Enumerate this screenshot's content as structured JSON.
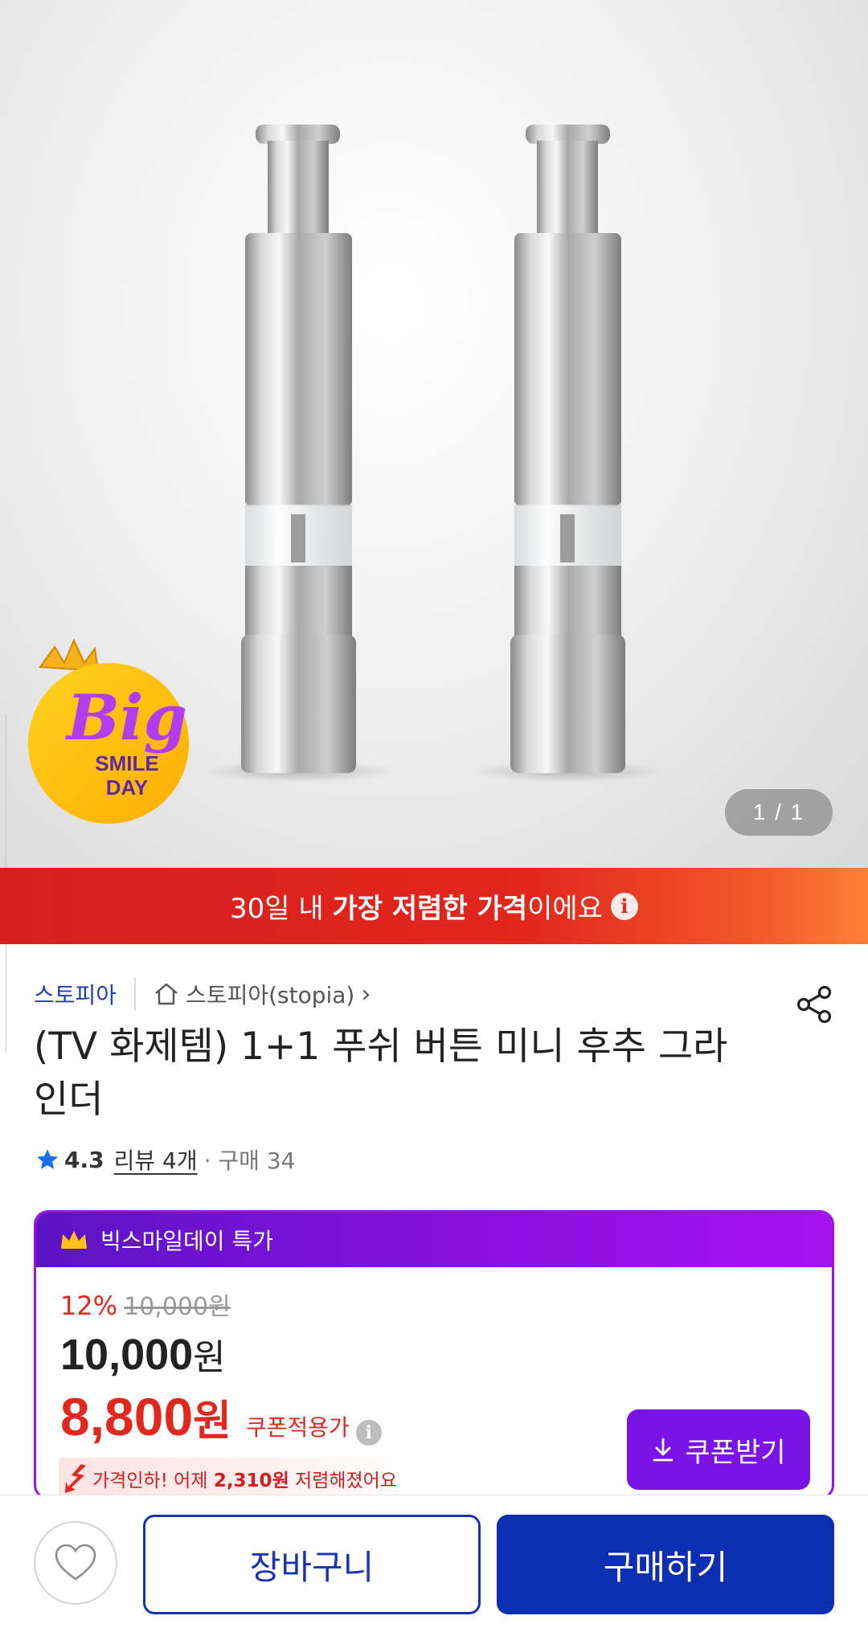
{
  "hero": {
    "image_counter": "1 / 1",
    "badge": {
      "word": "Big",
      "line1": "SMILE",
      "line2": "DAY"
    }
  },
  "banner": {
    "prefix": "30일 내 ",
    "highlight": "가장 저렴한 가격",
    "suffix": "이에요",
    "info_icon": "i"
  },
  "store": {
    "name": "스토피아",
    "shop_link": "스토피아(stopia)",
    "shop_chevron": "›"
  },
  "product": {
    "title": "(TV 화제템) 1+1 푸쉬 버튼 미니 후추 그라인더",
    "rating": "4.3",
    "reviews": "리뷰 4개",
    "purchases": "· 구매 34"
  },
  "deal": {
    "header": "빅스마일데이 특가",
    "discount_rate": "12%",
    "original_price": "10,000원",
    "price_value": "10,000",
    "price_unit": "원",
    "coupon_price_value": "8,800",
    "coupon_price_unit": "원",
    "coupon_label": "쿠폰적용가",
    "coupon_button": "쿠폰받기",
    "drop_notice_prefix": "가격인하! 어제 ",
    "drop_notice_amount": "2,310원",
    "drop_notice_suffix": " 저렴해졌어요"
  },
  "bottom": {
    "cart": "장바구니",
    "buy": "구매하기"
  },
  "colors": {
    "brand_blue": "#0b2fb0",
    "sale_red": "#e0281f",
    "deal_purple": "#8a10e0"
  },
  "icons": [
    "share-icon",
    "home-icon",
    "star-icon",
    "crown-icon",
    "download-icon",
    "heart-icon",
    "info-icon",
    "price-drop-arrow-icon"
  ]
}
